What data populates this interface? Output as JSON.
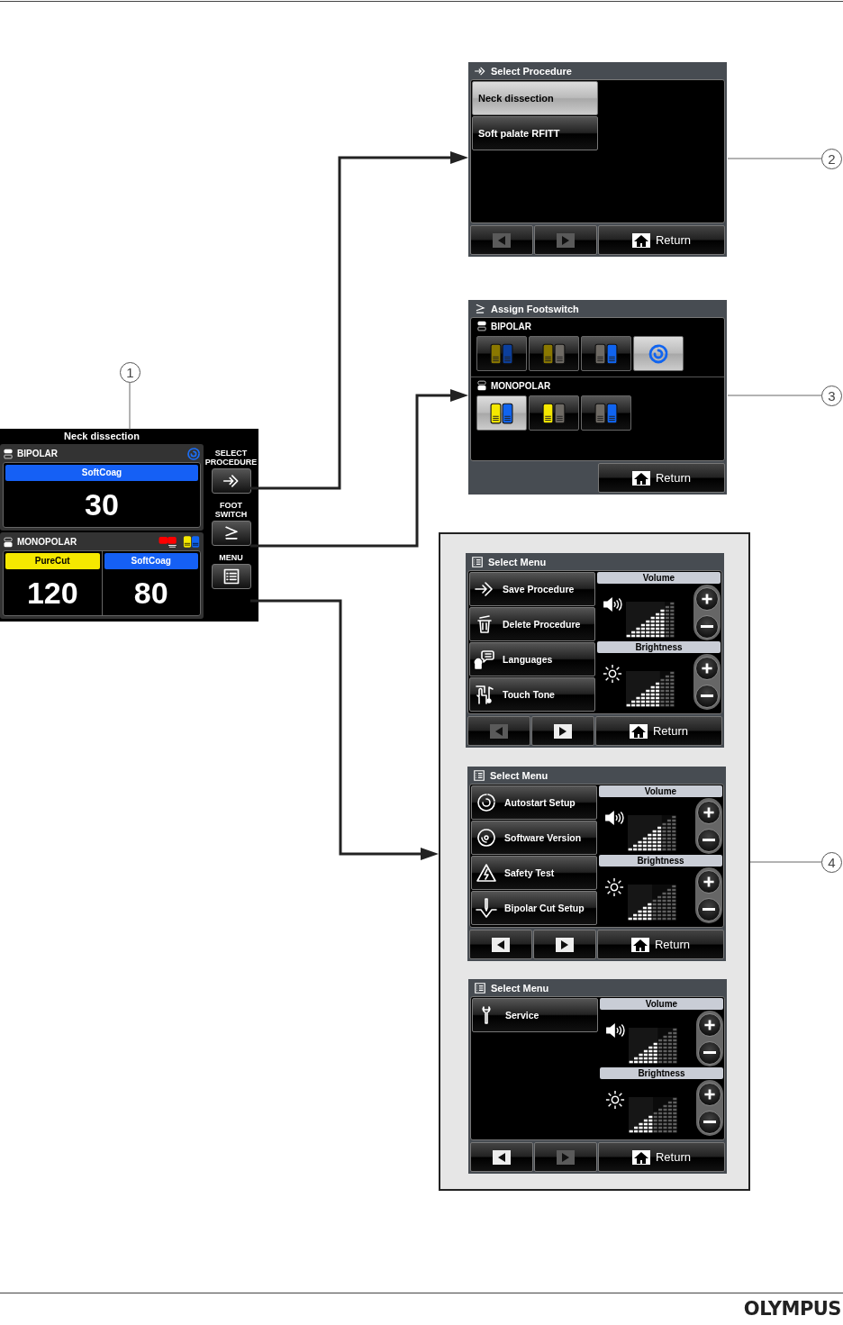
{
  "device": {
    "title": "Neck dissection",
    "bipolar": {
      "label": "BIPOLAR",
      "modes": [
        {
          "name": "SoftCoag",
          "color": "#1560f5",
          "value": "30"
        }
      ]
    },
    "monopolar": {
      "label": "MONOPOLAR",
      "modes": [
        {
          "name": "PureCut",
          "color": "#f5e800",
          "value": "120"
        },
        {
          "name": "SoftCoag",
          "color": "#1560f5",
          "value": "80"
        }
      ]
    },
    "side_buttons": [
      {
        "label": "SELECT PROCEDURE",
        "kind": "procedure"
      },
      {
        "label": "FOOT SWITCH",
        "kind": "footswitch"
      },
      {
        "label": "MENU",
        "kind": "menu"
      }
    ]
  },
  "select_procedure": {
    "title": "Select Procedure",
    "items": [
      {
        "label": "Neck dissection",
        "selected": true
      },
      {
        "label": "Soft palate RFITT",
        "selected": false
      }
    ],
    "prev": {
      "disabled": true
    },
    "next": {
      "disabled": true
    },
    "return": "Return"
  },
  "assign_footswitch": {
    "title": "Assign Footswitch",
    "groups": [
      {
        "label": "BIPOLAR",
        "kind": "bipolar",
        "options": [
          {
            "kind": "pedals",
            "selected": false,
            "pedals": [
              {
                "color": "#8a7800"
              },
              {
                "color": "#0c3f9c"
              }
            ]
          },
          {
            "kind": "pedals",
            "selected": false,
            "pedals": [
              {
                "color": "#8a7800"
              },
              {
                "color": "#6e6a64"
              }
            ]
          },
          {
            "kind": "pedals",
            "selected": false,
            "pedals": [
              {
                "color": "#6e6a64"
              },
              {
                "color": "#1064f0"
              }
            ]
          },
          {
            "kind": "autostart",
            "selected": true
          }
        ]
      },
      {
        "label": "MONOPOLAR",
        "kind": "monopolar",
        "options": [
          {
            "kind": "pedals",
            "selected": true,
            "pedals": [
              {
                "color": "#f5e800"
              },
              {
                "color": "#1064f0"
              }
            ]
          },
          {
            "kind": "pedals",
            "selected": false,
            "pedals": [
              {
                "color": "#f5e800"
              },
              {
                "color": "#6e6a64"
              }
            ]
          },
          {
            "kind": "pedals",
            "selected": false,
            "pedals": [
              {
                "color": "#6e6a64"
              },
              {
                "color": "#1064f0"
              }
            ]
          }
        ]
      }
    ],
    "return": "Return"
  },
  "menus": [
    {
      "title": "Select Menu",
      "items": [
        {
          "label": "Save Procedure",
          "kind": "save"
        },
        {
          "label": "Delete Procedure",
          "kind": "delete"
        },
        {
          "label": "Languages",
          "kind": "languages"
        },
        {
          "label": "Touch Tone",
          "kind": "touch_tone"
        }
      ],
      "volume": {
        "label": "Volume",
        "level": 0.8
      },
      "brightness": {
        "label": "Brightness",
        "level": 0.7
      },
      "prev": {
        "disabled": true
      },
      "next": {
        "disabled": false
      },
      "return": "Return"
    },
    {
      "title": "Select Menu",
      "items": [
        {
          "label": "Autostart Setup",
          "kind": "autostart"
        },
        {
          "label": "Software Version",
          "kind": "software"
        },
        {
          "label": "Safety Test",
          "kind": "safety"
        },
        {
          "label": "Bipolar Cut Setup",
          "kind": "bipolar_cut"
        }
      ],
      "volume": {
        "label": "Volume",
        "level": 0.7
      },
      "brightness": {
        "label": "Brightness",
        "level": 0.5
      },
      "prev": {
        "disabled": false
      },
      "next": {
        "disabled": false
      },
      "return": "Return"
    },
    {
      "title": "Select Menu",
      "items": [
        {
          "label": "Service",
          "kind": "service"
        }
      ],
      "volume": {
        "label": "Volume",
        "level": 0.6
      },
      "brightness": {
        "label": "Brightness",
        "level": 0.5
      },
      "prev": {
        "disabled": false
      },
      "next": {
        "disabled": true
      },
      "return": "Return"
    }
  ],
  "callouts": [
    "1",
    "2",
    "3",
    "4"
  ],
  "logo": "OLYMPUS"
}
